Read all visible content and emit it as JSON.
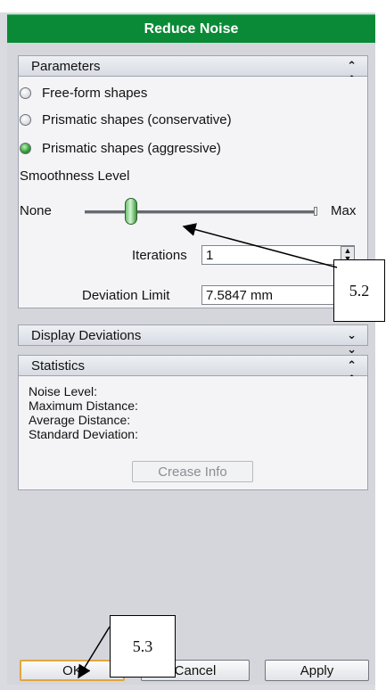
{
  "dialog": {
    "title": "Reduce Noise"
  },
  "parameters": {
    "header": "Parameters",
    "options": [
      {
        "label": "Free-form shapes",
        "selected": false
      },
      {
        "label": "Prismatic shapes (conservative)",
        "selected": false
      },
      {
        "label": "Prismatic shapes (aggressive)",
        "selected": true
      }
    ],
    "smoothness_label": "Smoothness Level",
    "slider_min_label": "None",
    "slider_max_label": "Max",
    "slider_level": 0.2,
    "iterations_label": "Iterations",
    "iterations_value": "1",
    "deviation_label": "Deviation Limit",
    "deviation_value": "7.5847 mm"
  },
  "display_deviations": {
    "header": "Display Deviations"
  },
  "statistics": {
    "header": "Statistics",
    "lines": [
      "Noise Level:",
      "Maximum Distance:",
      "Average Distance:",
      "Standard Deviation:"
    ],
    "crease_button": "Crease Info"
  },
  "buttons": {
    "ok": "OK",
    "cancel": "Cancel",
    "apply": "Apply"
  },
  "callouts": {
    "c1": "5.2",
    "c2": "5.3"
  },
  "icons": {
    "collapse": "chevron-up-icon",
    "expand": "chevron-down-icon"
  },
  "colors": {
    "title_bar": "#0a8a36",
    "selected_radio": "#2c9a2c",
    "ok_border": "#e0a640"
  }
}
